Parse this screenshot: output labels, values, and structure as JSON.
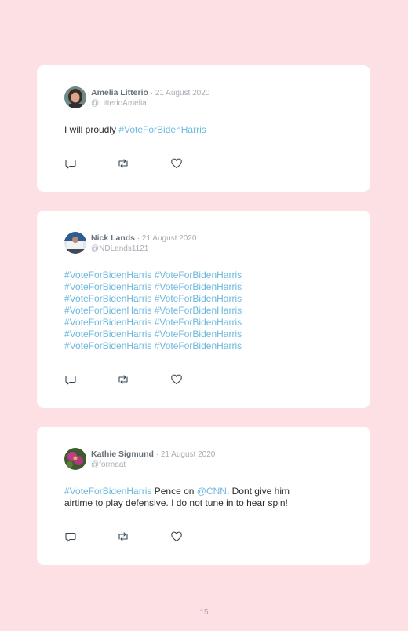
{
  "tweets": [
    {
      "name": "Amelia Litterio",
      "separator": " · ",
      "date": "21 August 2020",
      "handle": "@LitterioAmelia",
      "text_lines": [
        [
          {
            "t": "I will proudly ",
            "k": "plain"
          },
          {
            "t": "#VoteForBidenHarris",
            "k": "hashtag"
          }
        ]
      ]
    },
    {
      "name": "Nick Lands",
      "separator": " · ",
      "date": "21 August 2020",
      "handle": "@NDLands1121",
      "text_lines": [
        [
          {
            "t": "#VoteForBidenHarris",
            "k": "hashtag"
          },
          {
            "t": " ",
            "k": "plain"
          },
          {
            "t": "#VoteForBidenHarris",
            "k": "hashtag"
          }
        ],
        [
          {
            "t": "#VoteForBidenHarris",
            "k": "hashtag"
          },
          {
            "t": " ",
            "k": "plain"
          },
          {
            "t": "#VoteForBidenHarris",
            "k": "hashtag"
          }
        ],
        [
          {
            "t": "#VoteForBidenHarris",
            "k": "hashtag"
          },
          {
            "t": " ",
            "k": "plain"
          },
          {
            "t": "#VoteForBidenHarris",
            "k": "hashtag"
          }
        ],
        [
          {
            "t": "#VoteForBidenHarris",
            "k": "hashtag"
          },
          {
            "t": " ",
            "k": "plain"
          },
          {
            "t": "#VoteForBidenHarris",
            "k": "hashtag"
          }
        ],
        [
          {
            "t": "#VoteForBidenHarris",
            "k": "hashtag"
          },
          {
            "t": " ",
            "k": "plain"
          },
          {
            "t": "#VoteForBidenHarris",
            "k": "hashtag"
          }
        ],
        [
          {
            "t": "#VoteForBidenHarris",
            "k": "hashtag"
          },
          {
            "t": " ",
            "k": "plain"
          },
          {
            "t": "#VoteForBidenHarris",
            "k": "hashtag"
          }
        ],
        [
          {
            "t": "#VoteForBidenHarris",
            "k": "hashtag"
          },
          {
            "t": " ",
            "k": "plain"
          },
          {
            "t": "#VoteForBidenHarris",
            "k": "hashtag"
          }
        ]
      ]
    },
    {
      "name": "Kathie Sigmund",
      "separator": " · ",
      "date": "21 August 2020",
      "handle": "@formaat",
      "text_lines": [
        [
          {
            "t": "#VoteForBidenHarris",
            "k": "hashtag"
          },
          {
            "t": " Pence on ",
            "k": "plain"
          },
          {
            "t": "@CNN",
            "k": "mention"
          },
          {
            "t": ". Dont give him",
            "k": "plain"
          }
        ],
        [
          {
            "t": "airtime to play defensive. I do not tune in to hear spin!",
            "k": "plain"
          }
        ]
      ]
    }
  ],
  "actions": {
    "reply_icon": "reply-icon",
    "retweet_icon": "retweet-icon",
    "like_icon": "heart-icon"
  },
  "colors": {
    "background": "#fde0e4",
    "card": "#ffffff",
    "link": "#6cb9de",
    "muted": "#a7aeb5"
  },
  "page_number": "15"
}
